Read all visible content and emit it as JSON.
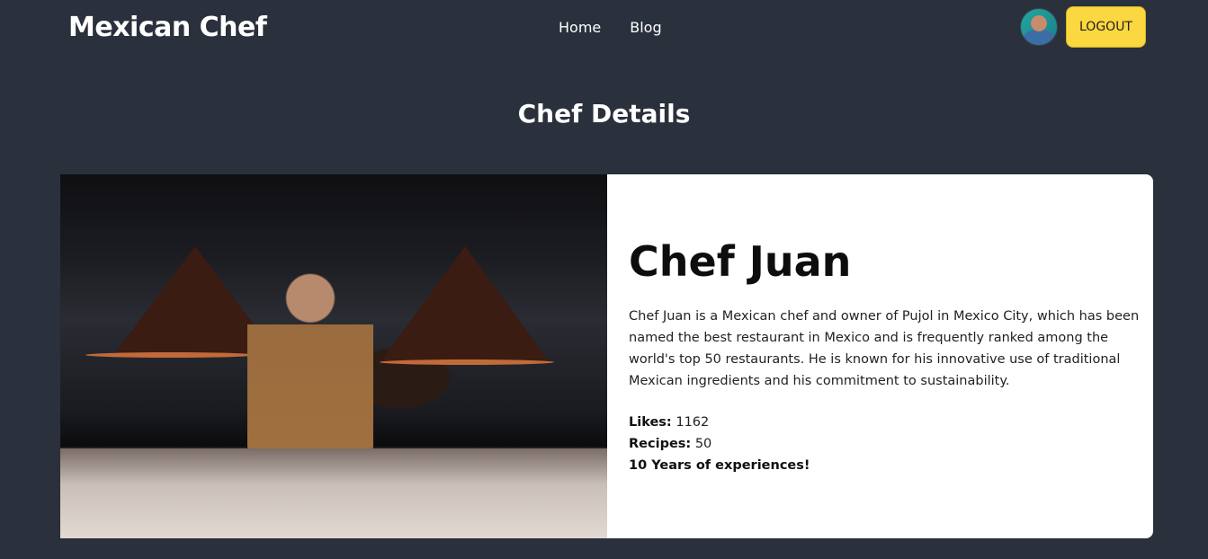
{
  "header": {
    "brand": "Mexican Chef",
    "nav": [
      {
        "label": "Home"
      },
      {
        "label": "Blog"
      }
    ],
    "logout_label": "LOGOUT"
  },
  "page": {
    "title": "Chef Details"
  },
  "chef": {
    "name": "Chef Juan",
    "bio": "Chef Juan is a Mexican chef and owner of Pujol in Mexico City, which has been named the best restaurant in Mexico and is frequently ranked among the world's top 50 restaurants. He is known for his innovative use of traditional Mexican ingredients and his commitment to sustainability.",
    "likes_label": "Likes:",
    "likes": "1162",
    "recipes_label": "Recipes:",
    "recipes": "50",
    "experience": "10 Years of experiences!"
  },
  "colors": {
    "background": "#2a303c",
    "accent": "#fbd740",
    "card": "#ffffff"
  },
  "icons": {
    "avatar": "user-avatar-photo"
  }
}
